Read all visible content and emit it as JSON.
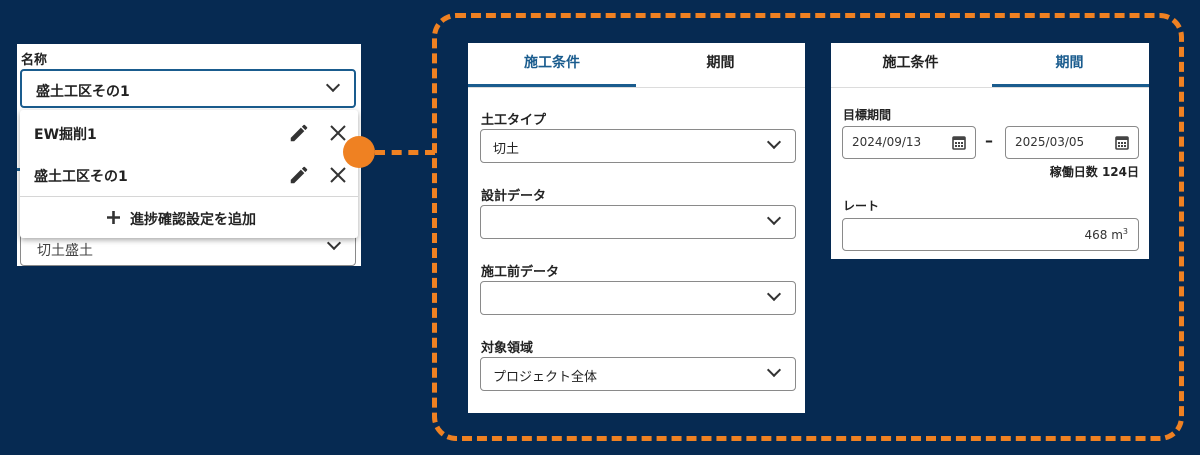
{
  "left_panel": {
    "name_label": "名称",
    "selected_name": "盛土工区その1",
    "dropdown_items": [
      "EW掘削1",
      "盛土工区その1"
    ],
    "add_label": "進捗確認設定を追加",
    "type_value": "切土盛土"
  },
  "card_conditions": {
    "tabs": [
      "施工条件",
      "期間"
    ],
    "active_tab": "施工条件",
    "fields": [
      {
        "label": "土工タイプ",
        "value": "切土"
      },
      {
        "label": "設計データ",
        "value": ""
      },
      {
        "label": "施工前データ",
        "value": ""
      },
      {
        "label": "対象領域",
        "value": "プロジェクト全体"
      }
    ]
  },
  "card_period": {
    "tabs": [
      "施工条件",
      "期間"
    ],
    "active_tab": "期間",
    "target_period_label": "目標期間",
    "start_date": "2024/09/13",
    "end_date": "2025/03/05",
    "separator": "–",
    "working_days": "稼働日数 124日",
    "rate_label": "レート",
    "rate_value": "468 m",
    "rate_unit_sup": "3"
  },
  "colors": {
    "background": "#062a52",
    "accent": "#1a5c8e",
    "highlight": "#ef8122"
  }
}
